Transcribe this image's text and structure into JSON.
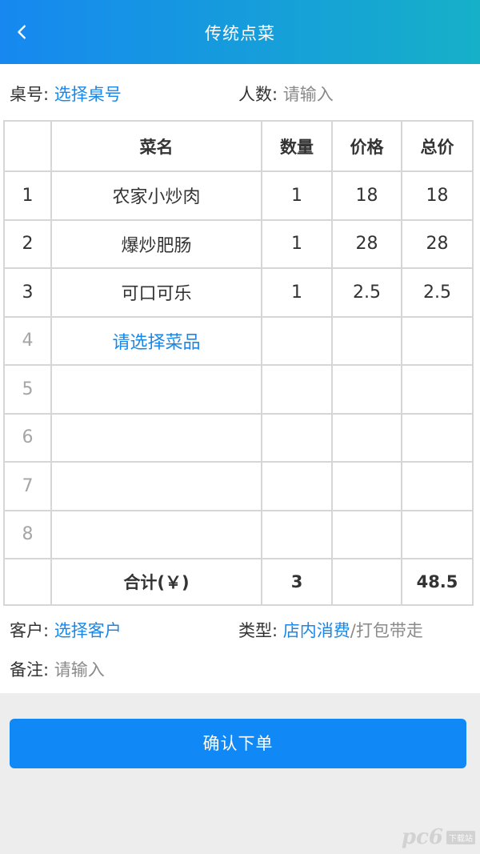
{
  "header": {
    "title": "传统点菜",
    "back_icon": "chevron-left-icon"
  },
  "form_top": {
    "table_label": "桌号:",
    "table_value": "选择桌号",
    "people_label": "人数:",
    "people_placeholder": "请输入"
  },
  "order_table": {
    "headers": [
      "",
      "菜名",
      "数量",
      "价格",
      "总价"
    ],
    "rows": [
      {
        "no": "1",
        "name": "农家小炒肉",
        "qty": "1",
        "price": "18",
        "total": "18"
      },
      {
        "no": "2",
        "name": "爆炒肥肠",
        "qty": "1",
        "price": "28",
        "total": "28"
      },
      {
        "no": "3",
        "name": "可口可乐",
        "qty": "1",
        "price": "2.5",
        "total": "2.5"
      },
      {
        "no": "4",
        "name": "请选择菜品",
        "qty": "",
        "price": "",
        "total": ""
      },
      {
        "no": "5",
        "name": "",
        "qty": "",
        "price": "",
        "total": ""
      },
      {
        "no": "6",
        "name": "",
        "qty": "",
        "price": "",
        "total": ""
      },
      {
        "no": "7",
        "name": "",
        "qty": "",
        "price": "",
        "total": ""
      },
      {
        "no": "8",
        "name": "",
        "qty": "",
        "price": "",
        "total": ""
      }
    ],
    "summary": {
      "label": "合计(￥)",
      "qty": "3",
      "total": "48.5"
    }
  },
  "form_bottom": {
    "customer_label": "客户:",
    "customer_value": "选择客户",
    "type_label": "类型:",
    "type_selected": "店内消费",
    "type_separator": "/",
    "type_other": "打包带走",
    "note_label": "备注:",
    "note_placeholder": "请输入"
  },
  "actions": {
    "confirm_label": "确认下单"
  },
  "watermark": {
    "logo": "pc6",
    "badge": "下载站"
  },
  "colors": {
    "accent": "#1088f6",
    "header_start": "#1688f0",
    "header_end": "#16b0c8",
    "link": "#1a87e8"
  }
}
